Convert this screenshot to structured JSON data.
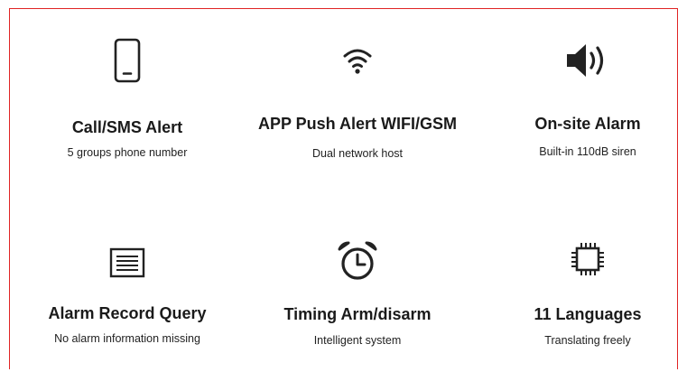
{
  "features": [
    {
      "title": "Call/SMS Alert",
      "subtitle": "5 groups phone number",
      "icon": "smartphone-icon"
    },
    {
      "title": "APP Push Alert  WIFI/GSM",
      "subtitle": "Dual network host",
      "icon": "wifi-icon"
    },
    {
      "title": "On-site Alarm",
      "subtitle": "Built-in 110dB siren",
      "icon": "speaker-icon"
    },
    {
      "title": "Alarm Record Query",
      "subtitle": "No alarm information missing",
      "icon": "document-list-icon"
    },
    {
      "title": "Timing Arm/disarm",
      "subtitle": "Intelligent system",
      "icon": "alarm-clock-icon"
    },
    {
      "title": "11 Languages",
      "subtitle": "Translating freely",
      "icon": "chip-icon"
    }
  ],
  "colors": {
    "border": "#e02424",
    "icon": "#222222",
    "text": "#1a1a1a"
  }
}
